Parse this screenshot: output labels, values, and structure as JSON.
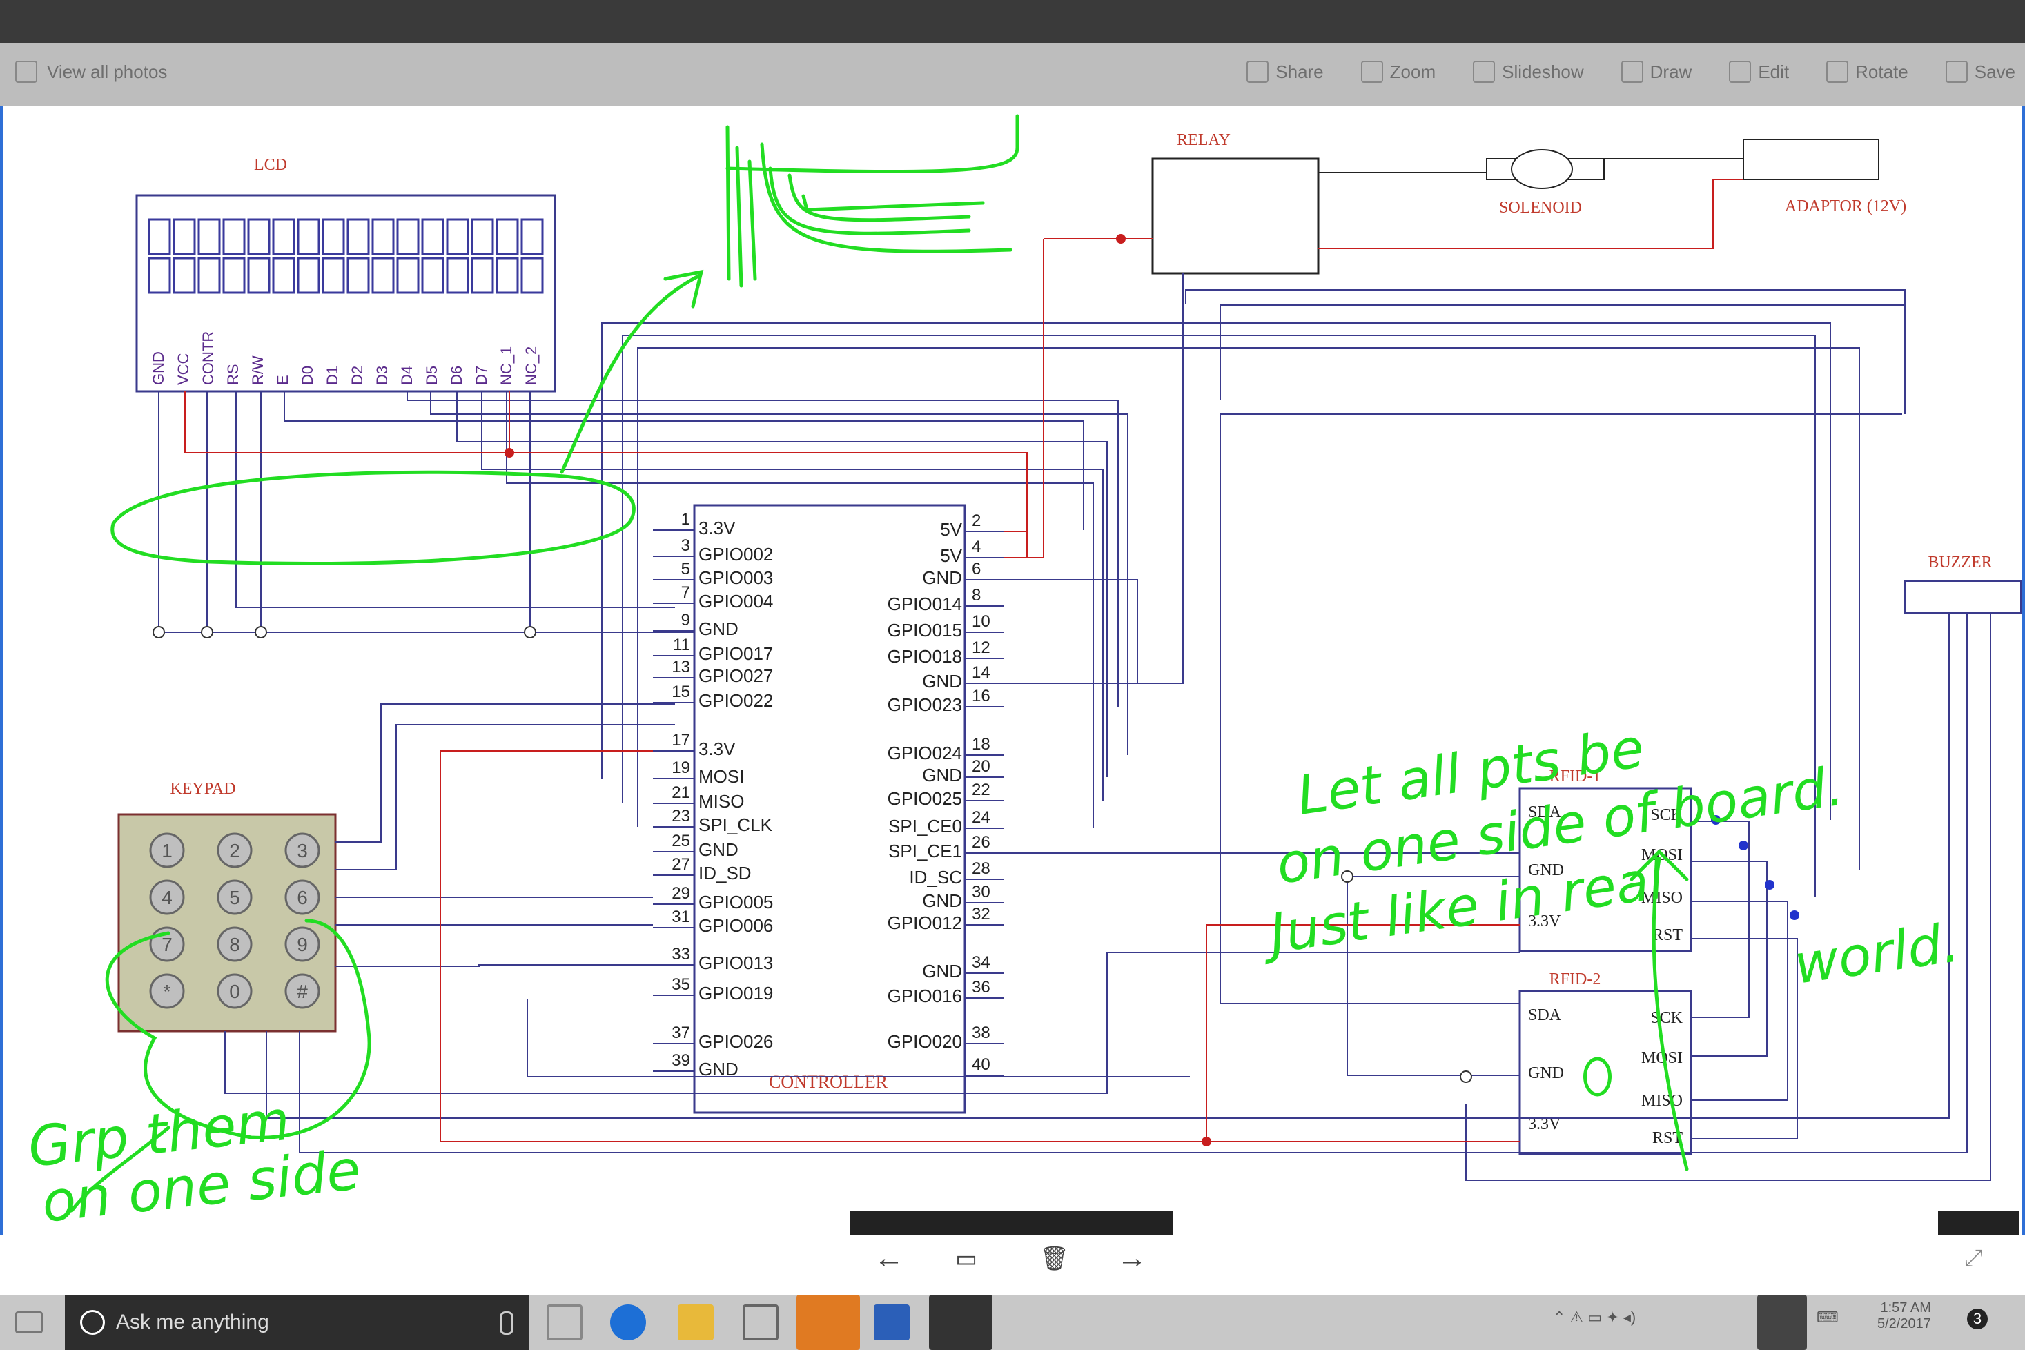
{
  "window": {
    "back_label": "View all photos",
    "tools": [
      {
        "label": "Share",
        "icon": "share-icon"
      },
      {
        "label": "Zoom",
        "icon": "zoom-icon"
      },
      {
        "label": "Slideshow",
        "icon": "slideshow-icon"
      },
      {
        "label": "Draw",
        "icon": "draw-icon"
      },
      {
        "label": "Edit",
        "icon": "edit-icon"
      },
      {
        "label": "Rotate",
        "icon": "rotate-icon"
      },
      {
        "label": "Save",
        "icon": "save-icon"
      }
    ]
  },
  "schematic": {
    "lcd": {
      "title": "LCD",
      "pins": [
        "GND",
        "VCC",
        "CONTR",
        "RS",
        "R/W",
        "E",
        "D0",
        "D1",
        "D2",
        "D3",
        "D4",
        "D5",
        "D6",
        "D7",
        "NC_1",
        "NC_2"
      ]
    },
    "relay": "RELAY",
    "solenoid": "SOLENOID",
    "adaptor": "ADAPTOR (12V)",
    "buzzer": "BUZZER",
    "keypad": {
      "title": "KEYPAD",
      "keys": [
        "1",
        "2",
        "3",
        "4",
        "5",
        "6",
        "7",
        "8",
        "9",
        "*",
        "0",
        "#"
      ]
    },
    "controller": {
      "title": "CONTROLLER",
      "left": [
        [
          "1",
          "3.3V"
        ],
        [
          "3",
          "GPIO002"
        ],
        [
          "5",
          "GPIO003"
        ],
        [
          "7",
          "GPIO004"
        ],
        [
          "9",
          "GND"
        ],
        [
          "11",
          "GPIO017"
        ],
        [
          "13",
          "GPIO027"
        ],
        [
          "15",
          "GPIO022"
        ],
        [
          "17",
          "3.3V"
        ],
        [
          "19",
          "MOSI"
        ],
        [
          "21",
          "MISO"
        ],
        [
          "23",
          "SPI_CLK"
        ],
        [
          "25",
          "GND"
        ],
        [
          "27",
          "ID_SD"
        ],
        [
          "29",
          "GPIO005"
        ],
        [
          "31",
          "GPIO006"
        ],
        [
          "33",
          "GPIO013"
        ],
        [
          "35",
          "GPIO019"
        ],
        [
          "37",
          "GPIO026"
        ],
        [
          "39",
          "GND"
        ]
      ],
      "right": [
        [
          "2",
          "5V"
        ],
        [
          "4",
          "5V"
        ],
        [
          "6",
          "GND"
        ],
        [
          "8",
          "GPIO014"
        ],
        [
          "10",
          "GPIO015"
        ],
        [
          "12",
          "GPIO018"
        ],
        [
          "14",
          "GND"
        ],
        [
          "16",
          "GPIO023"
        ],
        [
          "18",
          "GPIO024"
        ],
        [
          "20",
          "GND"
        ],
        [
          "22",
          "GPIO025"
        ],
        [
          "24",
          "SPI_CE0"
        ],
        [
          "26",
          "SPI_CE1"
        ],
        [
          "28",
          "ID_SC"
        ],
        [
          "30",
          "GND"
        ],
        [
          "32",
          "GPIO012"
        ],
        [
          "34",
          "GND"
        ],
        [
          "36",
          "GPIO016"
        ],
        [
          "38",
          "GPIO020"
        ],
        [
          "40",
          ""
        ]
      ]
    },
    "rfid1": {
      "title": "RFID-1",
      "left": [
        "SDA",
        "GND",
        "3.3V"
      ],
      "right": [
        "SCK",
        "MOSI",
        "MISO",
        "RST"
      ]
    },
    "rfid2": {
      "title": "RFID-2",
      "left": [
        "SDA",
        "GND",
        "3.3V"
      ],
      "right": [
        "SCK",
        "MOSI",
        "MISO",
        "RST"
      ]
    }
  },
  "annotations": {
    "note_right": [
      "Let all pts be",
      "on one side of board.",
      "Just like in real",
      "world."
    ],
    "note_left": [
      "Grp them",
      "on one side"
    ]
  },
  "taskbar": {
    "search_placeholder": "Ask me anything",
    "time": "1:57 AM",
    "date": "5/2/2017",
    "notifications": "3"
  },
  "colors": {
    "wire_blue": "#3a3a8c",
    "wire_red": "#c81e1e",
    "ink_green": "#22dd22",
    "label_red": "#c0392b",
    "pin_purple": "#5b2b8c"
  }
}
